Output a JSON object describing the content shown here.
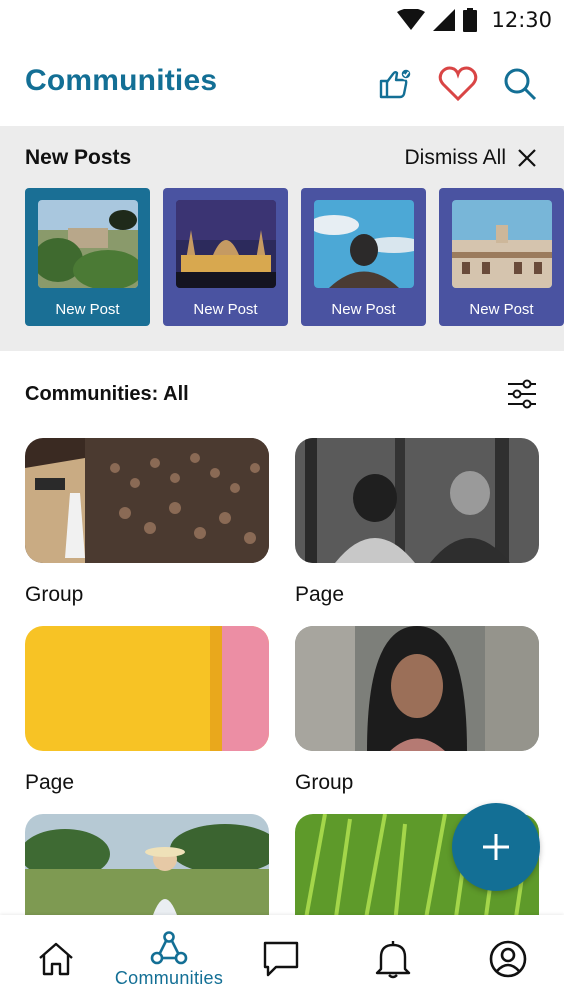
{
  "status_bar": {
    "time": "12:30"
  },
  "app_bar": {
    "title": "Communities"
  },
  "new_posts": {
    "title": "New Posts",
    "dismiss_label": "Dismiss All",
    "cards": [
      {
        "label": "New Post",
        "active": true
      },
      {
        "label": "New Post",
        "active": false
      },
      {
        "label": "New Post",
        "active": false
      },
      {
        "label": "New Post",
        "active": false
      }
    ]
  },
  "communities": {
    "title": "Communities: All",
    "tiles": [
      {
        "label": "Group"
      },
      {
        "label": "Page"
      },
      {
        "label": "Page"
      },
      {
        "label": "Group"
      },
      {
        "label": ""
      },
      {
        "label": ""
      }
    ]
  },
  "bottom_nav": {
    "items": [
      {
        "icon": "home-icon",
        "label": ""
      },
      {
        "icon": "communities-icon",
        "label": "Communities",
        "active": true
      },
      {
        "icon": "chat-icon",
        "label": ""
      },
      {
        "icon": "bell-icon",
        "label": ""
      },
      {
        "icon": "profile-icon",
        "label": ""
      }
    ]
  },
  "colors": {
    "accent": "#136f95",
    "card_active": "#1a6f95",
    "card_default": "#4a53a1",
    "heart": "#d94545",
    "strip_bg": "#ececec"
  }
}
